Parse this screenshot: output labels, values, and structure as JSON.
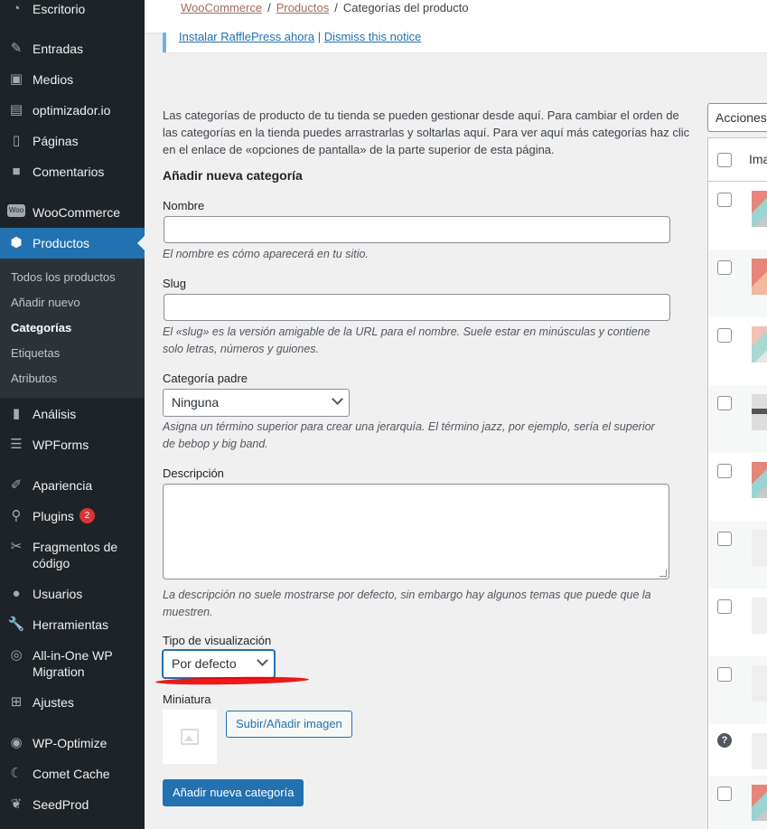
{
  "sidebar": {
    "items": [
      {
        "label": "Escritorio",
        "icon": "dashboard-icon"
      },
      {
        "label": "Entradas",
        "icon": "pin-icon"
      },
      {
        "label": "Medios",
        "icon": "media-icon"
      },
      {
        "label": "optimizador.io",
        "icon": "optimizer-icon"
      },
      {
        "label": "Páginas",
        "icon": "pages-icon"
      },
      {
        "label": "Comentarios",
        "icon": "comments-icon"
      },
      {
        "label": "WooCommerce",
        "icon": "woo-icon"
      },
      {
        "label": "Productos",
        "icon": "products-box-icon"
      },
      {
        "label": "Análisis",
        "icon": "analytics-icon"
      },
      {
        "label": "WPForms",
        "icon": "wpforms-icon"
      },
      {
        "label": "Apariencia",
        "icon": "appearance-icon"
      },
      {
        "label": "Plugins",
        "icon": "plugins-icon",
        "badge": "2"
      },
      {
        "label": "Fragmentos de código",
        "icon": "scissors-icon"
      },
      {
        "label": "Usuarios",
        "icon": "users-icon"
      },
      {
        "label": "Herramientas",
        "icon": "tools-icon"
      },
      {
        "label": "All-in-One WP Migration",
        "icon": "migration-icon"
      },
      {
        "label": "Ajustes",
        "icon": "settings-icon"
      },
      {
        "label": "WP-Optimize",
        "icon": "wp-optimize-icon"
      },
      {
        "label": "Comet Cache",
        "icon": "comet-cache-icon"
      },
      {
        "label": "SeedProd",
        "icon": "seedprod-icon"
      }
    ],
    "submenu": [
      "Todos los productos",
      "Añadir nuevo",
      "Categorías",
      "Etiquetas",
      "Atributos"
    ]
  },
  "breadcrumb": {
    "woocommerce": "WooCommerce",
    "productos": "Productos",
    "current": "Categorías del producto",
    "separator": "/"
  },
  "notice": {
    "install_link": "Instalar RafflePress ahora",
    "divider": "|",
    "dismiss_link": "Dismiss this notice"
  },
  "intro_text": "Las categorías de producto de tu tienda se pueden gestionar desde aquí. Para cambiar el orden de las categorías en la tienda puedes arrastrarlas y soltarlas aquí. Para ver aquí más categorías haz clic en el enlace de «opciones de pantalla» de la parte superior de esta página.",
  "form": {
    "heading": "Añadir nueva categoría",
    "name_label": "Nombre",
    "name_value": "",
    "name_help": "El nombre es cómo aparecerá en tu sitio.",
    "slug_label": "Slug",
    "slug_value": "",
    "slug_help": "El «slug» es la versión amigable de la URL para el nombre. Suele estar en minúsculas y contiene solo letras, números y guiones.",
    "parent_label": "Categoría padre",
    "parent_value": "Ninguna",
    "parent_help": "Asigna un término superior para crear una jerarquía. El término jazz, por ejemplo, sería el superior de bebop y big band.",
    "description_label": "Descripción",
    "description_help": "La descripción no suele mostrarse por defecto, sin embargo hay algunos temas que puede que la muestren.",
    "display_label": "Tipo de visualización",
    "display_value": "Por defecto",
    "thumbnail_label": "Miniatura",
    "upload_button": "Subir/Añadir imagen",
    "submit_button": "Añadir nueva categoría"
  },
  "table": {
    "bulk_actions": "Acciones en lote",
    "image_column": "Imagen",
    "help_glyph": "?"
  },
  "colors": {
    "sidebar_bg": "#1d2327",
    "accent": "#2271b1",
    "link_woo": "#a26c5b",
    "badge": "#d63638"
  }
}
